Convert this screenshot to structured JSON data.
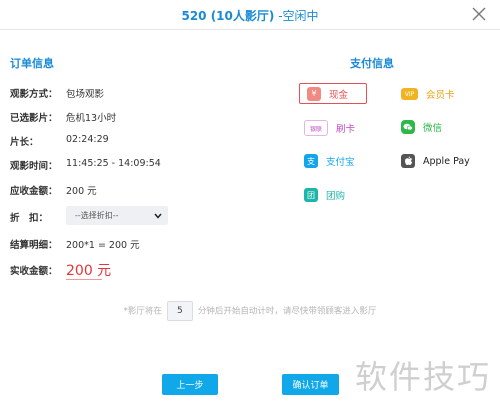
{
  "header": {
    "title": "520 (10人影厅)",
    "status": " -空闲中"
  },
  "order": {
    "section_title": "订单信息",
    "rows": [
      {
        "label": "观影方式：",
        "value": "包场观影"
      },
      {
        "label": "已选影片：",
        "value": "危机13小时"
      },
      {
        "label": "片长：",
        "value": "02:24:29"
      },
      {
        "label": "观影时间：",
        "value": "11:45:25 - 14:09:54"
      },
      {
        "label": "应收金额：",
        "value": "200 元"
      }
    ],
    "discount": {
      "label": "折　扣：",
      "selected": "--选择折扣--"
    },
    "settlement": {
      "label": "结算明细：",
      "value": "200*1 = 200 元"
    },
    "actual": {
      "label": "实收金额：",
      "value": "200 元"
    }
  },
  "payment": {
    "section_title": "支付信息",
    "methods": [
      {
        "name": "现金",
        "icon": "cash-icon",
        "selected": true
      },
      {
        "name": "会员卡",
        "icon": "vip-card-icon"
      },
      {
        "name": "刷卡",
        "icon": "unionpay-icon"
      },
      {
        "name": "微信",
        "icon": "wechat-icon"
      },
      {
        "name": "支付宝",
        "icon": "alipay-icon"
      },
      {
        "name": "Apple Pay",
        "icon": "apple-icon"
      },
      {
        "name": "团购",
        "icon": "group-buy-icon"
      }
    ]
  },
  "hint": {
    "prefix": "*影厅将在",
    "minutes": "5",
    "suffix": "分钟后开始自动计时，请尽快带领顾客进入影厅"
  },
  "buttons": {
    "prev": "上一步",
    "confirm": "确认订单"
  },
  "watermark": "软件技巧",
  "colors": {
    "accent": "#1a8ad6",
    "button": "#11a8ea",
    "price": "#e0373a",
    "cash": "#e15352"
  }
}
